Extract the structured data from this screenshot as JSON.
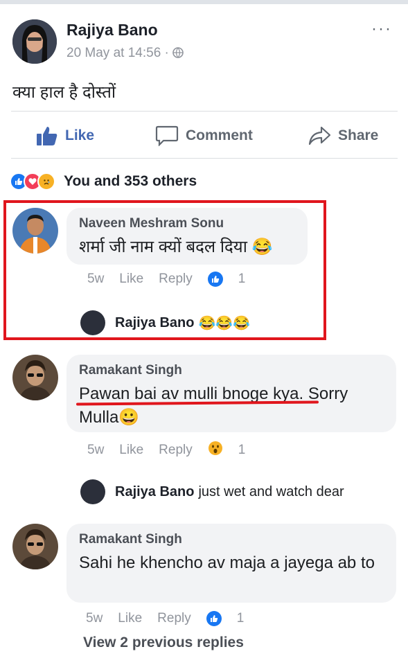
{
  "post": {
    "author": "Rajiya Bano",
    "meta": "20 May at 14:56 · ",
    "more": "···",
    "text": "क्या हाल है दोस्तों",
    "actions": {
      "like": "Like",
      "comment": "Comment",
      "share": "Share"
    },
    "reactions_text": "You and 353 others"
  },
  "comments": [
    {
      "name": "Naveen Meshram Sonu",
      "text": "शर्मा जी नाम क्यों बदल दिया 😂",
      "time": "5w",
      "like": "Like",
      "reply": "Reply",
      "count": "1",
      "reply_preview": {
        "name": "Rajiya Bano",
        "text": "😂😂😂"
      }
    },
    {
      "name": "Ramakant Singh",
      "text": "Pawan bai av mulli bnoge kya. Sorry Mulla😀",
      "time": "5w",
      "like": "Like",
      "reply": "Reply",
      "count": "1",
      "reply_preview": {
        "name": "Rajiya Bano",
        "text": "just wet and watch dear"
      }
    },
    {
      "name": "Ramakant Singh",
      "text": "Sahi he khencho av maja a jayega ab to",
      "time": "5w",
      "like": "Like",
      "reply": "Reply",
      "count": "1",
      "view_previous": "View 2 previous replies"
    }
  ],
  "colors": {
    "facebook_blue": "#4267b2",
    "highlight_red": "#e0161d"
  }
}
